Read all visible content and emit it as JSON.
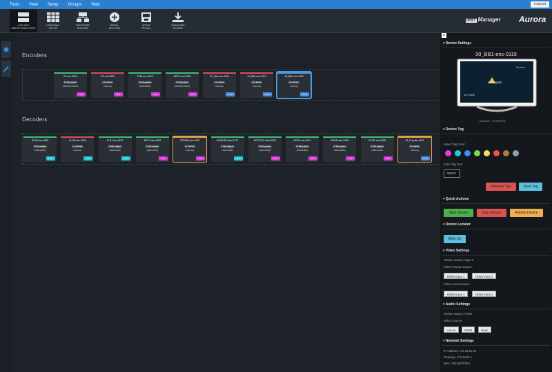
{
  "menu": [
    "Tools",
    "View",
    "Setup",
    "Groups",
    "Help"
  ],
  "logout_label": "Logout",
  "toolbar": [
    {
      "label": "LINE 5000\nMATRIX SWITCHING"
    },
    {
      "label": "VIDEOWALL\nSETUP"
    },
    {
      "label": "PRESTORE\nROUTING"
    },
    {
      "label": "SERIAL\nROUTING"
    },
    {
      "label": "SCENE\nRECALL"
    },
    {
      "label": "FIRMWARE\nUPDATE"
    }
  ],
  "brand": {
    "prefix": "IPBT",
    "name": "Manager",
    "logo": "Aurora"
  },
  "encoders_title": "Encoders",
  "decoders_title": "Decoders",
  "encoders": [
    {
      "name": "E4-enc-0000",
      "status": "STREAMING",
      "detail": "1080x60 Mbit/8p",
      "tag": "Pink",
      "bar": "#3ec07a",
      "tagcolor": "#d83cd8"
    },
    {
      "name": "CP-enc-0000",
      "status": "STOPPED",
      "detail": "Inactivity",
      "tag": "Pink",
      "bar": "#d9534f",
      "tagcolor": "#d83cd8"
    },
    {
      "name": "CHM-enc-0106",
      "status": "STREAMING",
      "detail": "1920x1080p",
      "tag": "Pink",
      "bar": "#3ec07a",
      "tagcolor": "#d83cd8"
    },
    {
      "name": "HDPX-dec-0108",
      "status": "STREAMING",
      "detail": "1080x60 Mbit/8p",
      "tag": "Pink",
      "bar": "#3ec07a",
      "tagcolor": "#d83cd8"
    },
    {
      "name": "20_Tele-enc-0106",
      "status": "STOPPED",
      "detail": "Inactivity",
      "tag": "None",
      "bar": "#d9534f",
      "tagcolor": "#4a8fe0"
    },
    {
      "name": "21_BB1-enc-0115",
      "status": "STOPPED",
      "detail": "Inactivity",
      "tag": "None",
      "bar": "#d9534f",
      "tagcolor": "#4a8fe0"
    },
    {
      "name": "30_BB1-enc-0115",
      "status": "STOPPED",
      "detail": "Inactivity",
      "tag": "None",
      "bar": "#4a9be0",
      "tagcolor": "#4a8fe0"
    }
  ],
  "decoders": [
    {
      "name": "IS-DB-dec-0008",
      "status": "STREAMING",
      "detail": "1920x1080p",
      "tag": "Cyan",
      "bar": "#3ec07a",
      "tagcolor": "#22c8d8"
    },
    {
      "name": "IS-DB-dec-0006",
      "status": "STOPPED",
      "detail": "Inactivity",
      "tag": "Cyan",
      "bar": "#d9534f",
      "tagcolor": "#22c8d8"
    },
    {
      "name": "IS-B7-dec-0007",
      "status": "STREAMING",
      "detail": "1920x1080p",
      "tag": "Cyan",
      "bar": "#3ec07a",
      "tagcolor": "#22c8d8"
    },
    {
      "name": "BETO-dec-0008",
      "status": "STREAMING",
      "detail": "1920x1080p",
      "tag": "Pink",
      "bar": "#3ec07a",
      "tagcolor": "#d83cd8"
    },
    {
      "name": "STBO80-dec-0076",
      "status": "STOPPED",
      "detail": "Inactivity",
      "tag": "Pink",
      "bar": "#e0a050",
      "tagcolor": "#d83cd8"
    },
    {
      "name": "MODGEO-dec-0172",
      "status": "STREAMING",
      "detail": "1920x1080p",
      "tag": "Cyan",
      "bar": "#3ec07a",
      "tagcolor": "#22c8d8"
    },
    {
      "name": "BOTCHCH-dec-0028",
      "status": "STREAMING",
      "detail": "1920x1080p",
      "tag": "Pink",
      "bar": "#3ec07a",
      "tagcolor": "#d83cd8"
    },
    {
      "name": "HDGX-dec-0012",
      "status": "STREAMING",
      "detail": "1920x1080p",
      "tag": "Pink",
      "bar": "#3ec07a",
      "tagcolor": "#d83cd8"
    },
    {
      "name": "MGVB-dec-0108",
      "status": "STREAMING",
      "detail": "1920x1080p",
      "tag": "Pink",
      "bar": "#3ec07a",
      "tagcolor": "#d83cd8"
    },
    {
      "name": "KTMT-dec-0068",
      "status": "STREAMING",
      "detail": "1920x1080p",
      "tag": "Pink",
      "bar": "#3ec07a",
      "tagcolor": "#d83cd8"
    },
    {
      "name": "31_Proj-dec-0115",
      "status": "STOPPED",
      "detail": "Inactivity",
      "tag": "None",
      "bar": "#e0a050",
      "tagcolor": "#4a8fe0"
    }
  ],
  "panel": {
    "device_settings": "Device Settings",
    "device_name": "30_BB1-enc-0115",
    "preview_title": "Preview",
    "no_signal": "No Signal",
    "no_signal_sub": "Not Stable",
    "preview_status": "Encoder - STOPPED",
    "device_tag": "Device Tag",
    "select_tag_color": "Select Tag Color:",
    "tag_colors": [
      "#e03ce0",
      "#25c8dc",
      "#3a8ff0",
      "#7ed957",
      "#f2e24a",
      "#f05050",
      "#b07a40",
      "#8aa0b4"
    ],
    "enter_tag_text": "Enter Tag Text:",
    "tag_input": "AB123",
    "remove_tag": "Remove Tag",
    "save_tag": "Save Tag",
    "quick_actions": "Quick Actions",
    "start_stream": "Start Stream",
    "stop_stream": "Stop Stream",
    "reboot_device": "Reboot Device",
    "device_locator": "Device Locator",
    "blink_on": "Blink On",
    "video_settings": "Video Settings",
    "stream_source": "Stream Source: Input 2",
    "select_stream_source": "Select Stream Source:",
    "hdmi1": "HDMI Input 1",
    "hdmi2": "HDMI Input 2",
    "select_local_source": "Select Local Source:",
    "audio_settings": "Audio Settings",
    "audio_source": "Stream Source: HDMI",
    "select_source": "Select Source:",
    "line_in": "Line In",
    "hdmi": "HDMI",
    "none": "None",
    "network_settings": "Network Settings",
    "ip": "IP Address: 172.16.81.36",
    "gateway": "Gateway: 172.16.81.1",
    "mac": "MAC: 0011D07F904"
  }
}
